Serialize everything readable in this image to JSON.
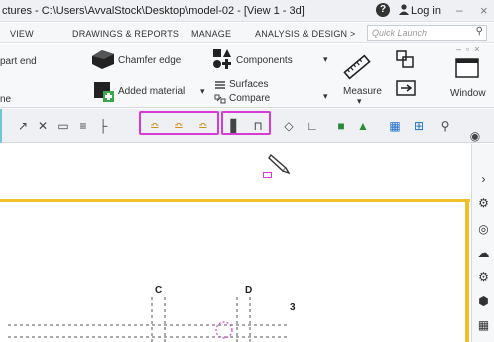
{
  "titlebar": {
    "title": "ctures - C:\\Users\\AvvalStock\\Desktop\\model-02  - [View 1 - 3d]",
    "login": "Log in",
    "min": "–",
    "close": "×",
    "help": "?"
  },
  "tabs": {
    "items": [
      "VIEW",
      "DRAWINGS & REPORTS",
      "MANAGE",
      "ANALYSIS & DESIGN >"
    ],
    "quick_launch_placeholder": "Quick Launch"
  },
  "ribbon": {
    "part_end": "part end",
    "ne": "ne",
    "chamfer_edge": "Chamfer edge",
    "added_material": "Added material",
    "components": "Components",
    "surfaces": "Surfaces",
    "compare": "Compare",
    "measure": "Measure",
    "window": "Window"
  },
  "viewport": {
    "grid_labels": [
      "C",
      "D",
      "3"
    ]
  },
  "colors": {
    "highlight": "#d63bd6",
    "view_border": "#f0c02a",
    "toolbar_accent": "#6ec7d6"
  }
}
